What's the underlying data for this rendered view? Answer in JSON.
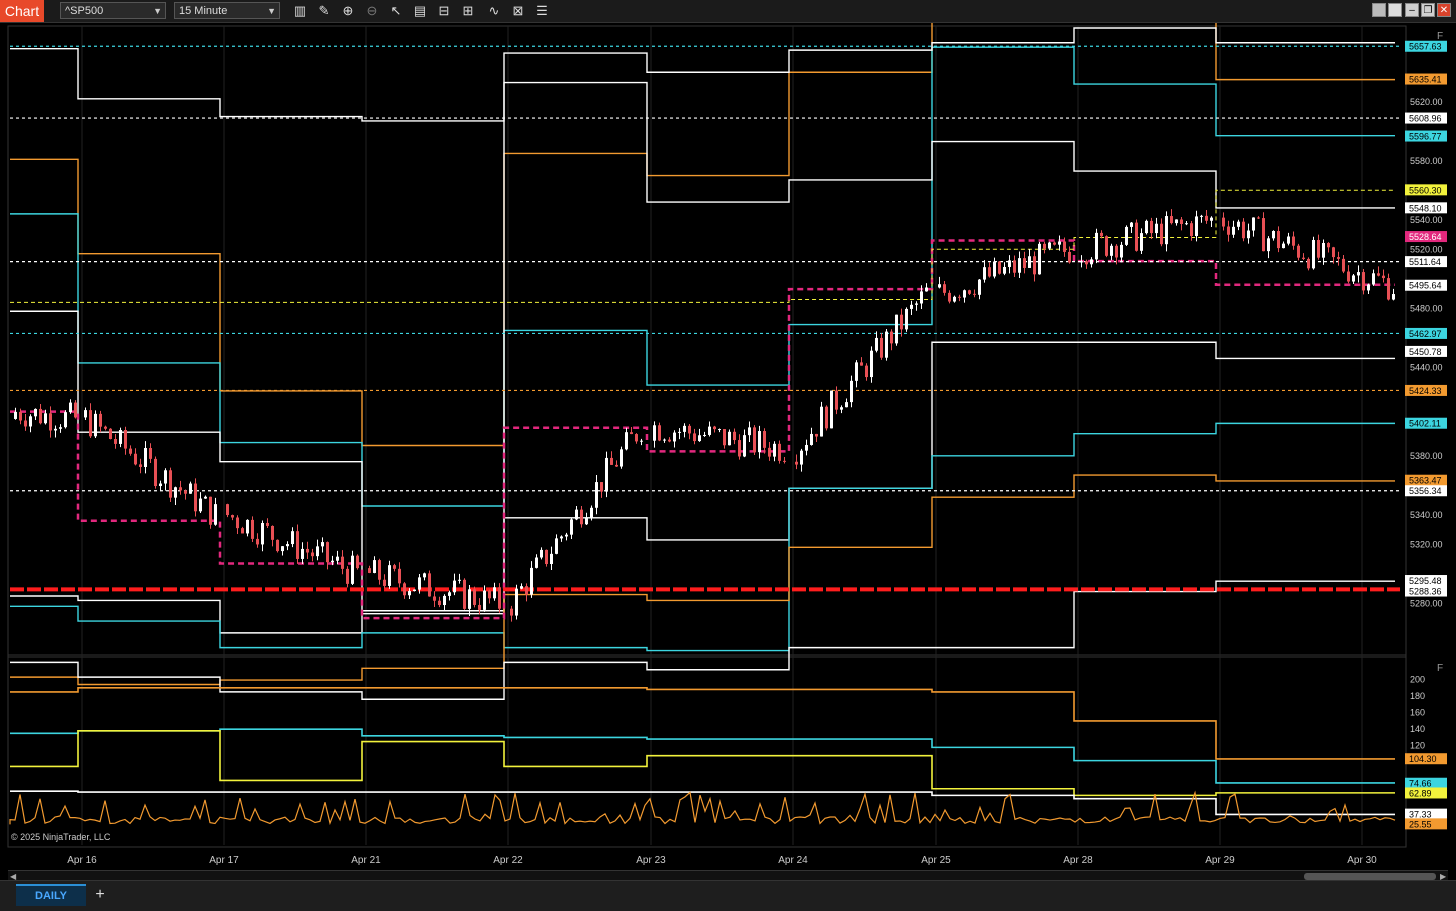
{
  "titlebar": {
    "app_label": "Chart",
    "instrument": "^SP500",
    "interval": "15 Minute"
  },
  "colors": {
    "background": "#000000",
    "orange": "#f29a30",
    "cyan": "#3cd5e0",
    "white": "#ffffff",
    "yellow": "#f2f23c",
    "magenta": "#e2287d",
    "red": "#ff1d1d",
    "candle_up": "#ffffff",
    "candle_down": "#e85055"
  },
  "chart_data": [
    {
      "type": "line",
      "panel": "price",
      "x_categories": [
        "Apr 16",
        "Apr 17",
        "Apr 21",
        "Apr 22",
        "Apr 23",
        "Apr 24",
        "Apr 25",
        "Apr 28",
        "Apr 29",
        "Apr 30"
      ],
      "y_axis": {
        "range": [
          5245,
          5670
        ],
        "ticks": [
          "5620.00",
          "5580.00",
          "5540.00",
          "5520.00",
          "5480.00",
          "5440.00",
          "5380.00",
          "5340.00",
          "5320.00",
          "5280.00"
        ]
      },
      "price_labels": [
        {
          "value": 5657.63,
          "text": "5657.63",
          "color": "cyan"
        },
        {
          "value": 5635.41,
          "text": "5635.41",
          "color": "orange"
        },
        {
          "value": 5608.96,
          "text": "5608.96",
          "color": "white"
        },
        {
          "value": 5596.77,
          "text": "5596.77",
          "color": "cyan"
        },
        {
          "value": 5560.3,
          "text": "5560.30",
          "color": "yellow"
        },
        {
          "value": 5548.1,
          "text": "5548.10",
          "color": "white"
        },
        {
          "value": 5528.64,
          "text": "5528.64",
          "color": "magenta"
        },
        {
          "value": 5511.64,
          "text": "5511.64",
          "color": "white"
        },
        {
          "value": 5495.64,
          "text": "5495.64",
          "color": "white"
        },
        {
          "value": 5462.97,
          "text": "5462.97",
          "color": "cyan"
        },
        {
          "value": 5450.78,
          "text": "5450.78",
          "color": "white"
        },
        {
          "value": 5424.33,
          "text": "5424.33",
          "color": "orange"
        },
        {
          "value": 5402.11,
          "text": "5402.11",
          "color": "cyan"
        },
        {
          "value": 5363.47,
          "text": "5363.47",
          "color": "orange"
        },
        {
          "value": 5356.34,
          "text": "5356.34",
          "color": "white"
        },
        {
          "value": 5295.48,
          "text": "5295.48",
          "color": "white"
        },
        {
          "value": 5288.36,
          "text": "5288.36",
          "color": "white"
        }
      ],
      "horizontal_levels": [
        {
          "value": 5657.63,
          "color": "cyan",
          "style": "dashed"
        },
        {
          "value": 5608.96,
          "color": "white",
          "style": "dashed"
        },
        {
          "value": 5511.64,
          "color": "white",
          "style": "dashed"
        },
        {
          "value": 5462.97,
          "color": "cyan",
          "style": "dashed"
        },
        {
          "value": 5424.33,
          "color": "orange",
          "style": "dashed"
        },
        {
          "value": 5356.34,
          "color": "white",
          "style": "dashed"
        },
        {
          "value": 5289.5,
          "color": "red",
          "style": "thick-dashed"
        }
      ],
      "step_series": [
        {
          "color": "orange",
          "values": [
            5581,
            5517,
            5424,
            5387,
            5585,
            5570,
            5640,
            5710,
            5700,
            5635
          ]
        },
        {
          "color": "cyan",
          "values": [
            5544,
            5443,
            5389,
            5346,
            5465,
            5428,
            5469,
            5657,
            5632,
            5597
          ]
        },
        {
          "color": "white",
          "values": [
            5478,
            5396,
            5376,
            5273,
            5633,
            5552,
            5567,
            5593,
            5573,
            5548
          ]
        },
        {
          "color": "white",
          "values": [
            5656,
            5622,
            5610,
            5607,
            5653,
            5640,
            5655,
            5660,
            5670,
            5660
          ]
        },
        {
          "color": "white",
          "values": [
            5285,
            5282,
            5260,
            5275,
            5338,
            5323,
            5358,
            5457,
            5457,
            5446
          ]
        },
        {
          "color": "cyan",
          "values": [
            5278,
            5268,
            5250,
            5260,
            5250,
            5248,
            5358,
            5380,
            5395,
            5402
          ]
        },
        {
          "color": "orange",
          "values": [
            5230,
            5225,
            5228,
            5236,
            5286,
            5282,
            5318,
            5352,
            5367,
            5363
          ]
        },
        {
          "color": "white",
          "values": [
            5240,
            5230,
            5220,
            5215,
            5240,
            5235,
            5250,
            5250,
            5288,
            5295
          ]
        }
      ],
      "magenta_box_series": {
        "values": [
          5410,
          5336,
          5307,
          5270,
          5399,
          5383,
          5493,
          5526,
          5512,
          5496
        ]
      },
      "yellow_series": {
        "values": [
          5484,
          5484,
          5484,
          5484,
          5484,
          5484,
          5486,
          5520,
          5528,
          5560
        ]
      },
      "close_series": [
        5405,
        5340,
        5300,
        5280,
        5400,
        5385,
        5490,
        5520,
        5540,
        5495
      ]
    },
    {
      "type": "line",
      "panel": "indicator",
      "y_axis": {
        "range": [
          0,
          220
        ],
        "ticks": [
          "200",
          "180",
          "160",
          "140",
          "120"
        ]
      },
      "value_labels": [
        {
          "value": 104.3,
          "text": "104.30",
          "color": "orange"
        },
        {
          "value": 74.66,
          "text": "74.66",
          "color": "cyan"
        },
        {
          "value": 62.89,
          "text": "62.89",
          "color": "yellow"
        },
        {
          "value": 37.33,
          "text": "37.33",
          "color": "white"
        },
        {
          "value": 25.55,
          "text": "25.55",
          "color": "orange"
        }
      ],
      "series": [
        {
          "color": "orange",
          "values": [
            185,
            190,
            190,
            190,
            190,
            188,
            188,
            185,
            150,
            104
          ]
        },
        {
          "color": "cyan",
          "values": [
            135,
            138,
            140,
            132,
            130,
            128,
            128,
            118,
            102,
            75
          ]
        },
        {
          "color": "yellow",
          "values": [
            95,
            138,
            78,
            125,
            95,
            108,
            108,
            68,
            60,
            63
          ]
        },
        {
          "color": "white",
          "values": [
            65,
            64,
            64,
            64,
            64,
            64,
            64,
            60,
            56,
            37
          ]
        }
      ],
      "oscillator": {
        "color": "orange",
        "base": 25,
        "peak": 60
      }
    }
  ],
  "footer": {
    "copyright": "© 2025 NinjaTrader, LLC",
    "tab_label": "DAILY",
    "add_tab": "+",
    "panel_flag": "F"
  }
}
